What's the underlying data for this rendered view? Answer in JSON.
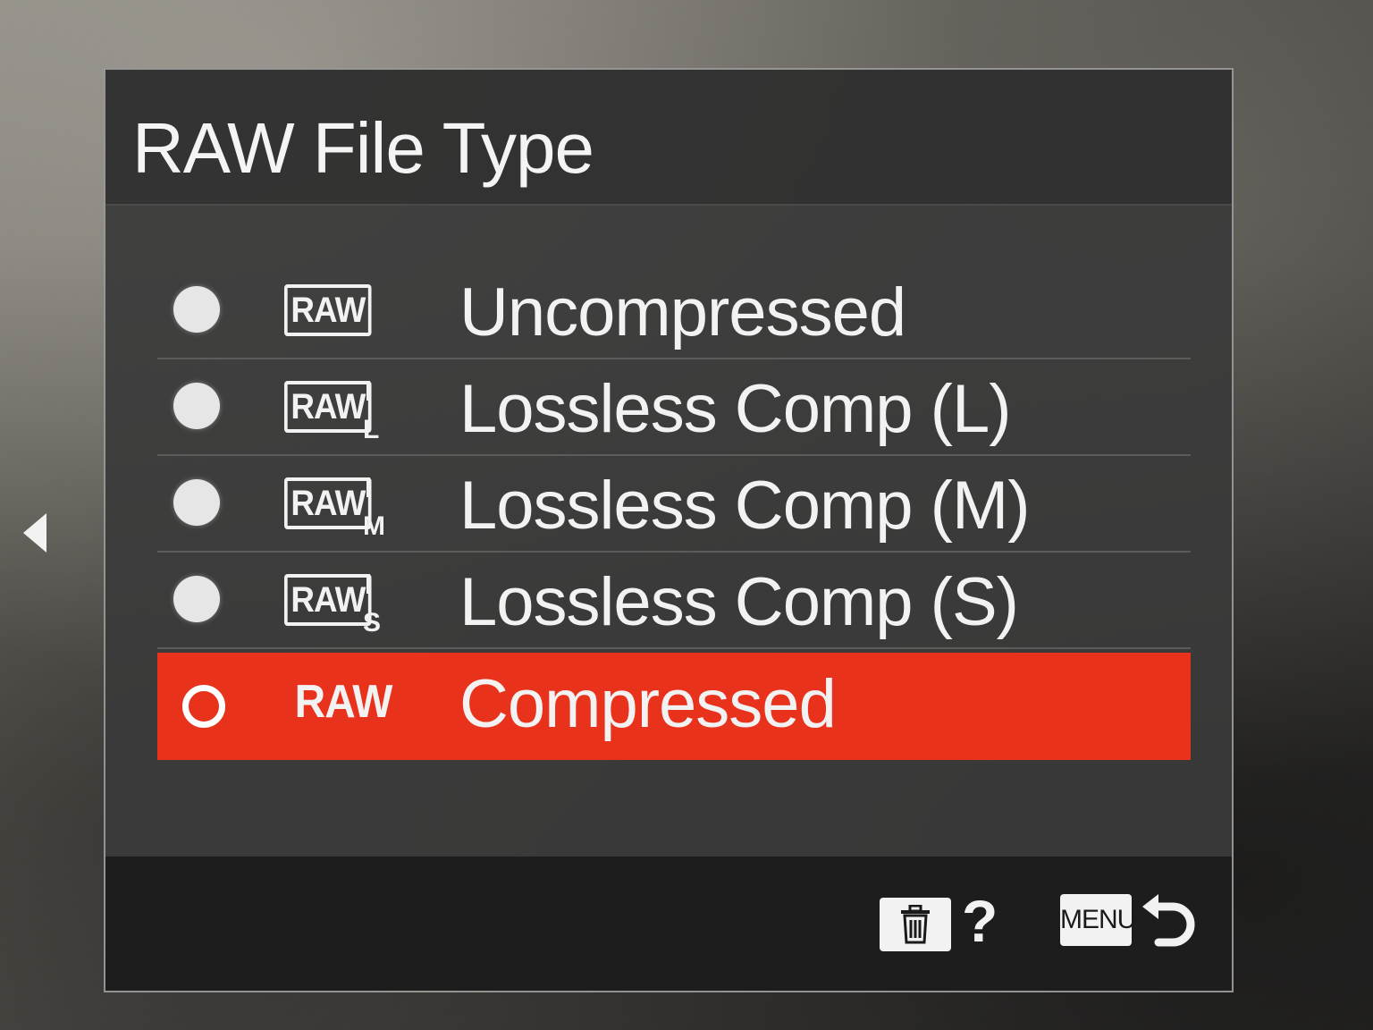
{
  "dialog": {
    "title": "RAW File Type"
  },
  "options": [
    {
      "badge": "RAW",
      "badge_sub": "",
      "label": "Uncompressed",
      "selected": false
    },
    {
      "badge": "RAW",
      "badge_sub": "L",
      "label": "Lossless Comp (L)",
      "selected": false
    },
    {
      "badge": "RAW",
      "badge_sub": "M",
      "label": "Lossless Comp (M)",
      "selected": false
    },
    {
      "badge": "RAW",
      "badge_sub": "S",
      "label": "Lossless Comp (S)",
      "selected": false
    },
    {
      "badge": "RAW",
      "badge_sub": "",
      "label": "Compressed",
      "selected": true
    }
  ],
  "footer": {
    "help_label": "?",
    "menu_label": "MENU",
    "trash_icon": "trash-icon",
    "back_icon": "return-icon"
  },
  "colors": {
    "selection": "#e8321c",
    "panel": "#3a3a3a",
    "text": "#f2f2f2"
  }
}
